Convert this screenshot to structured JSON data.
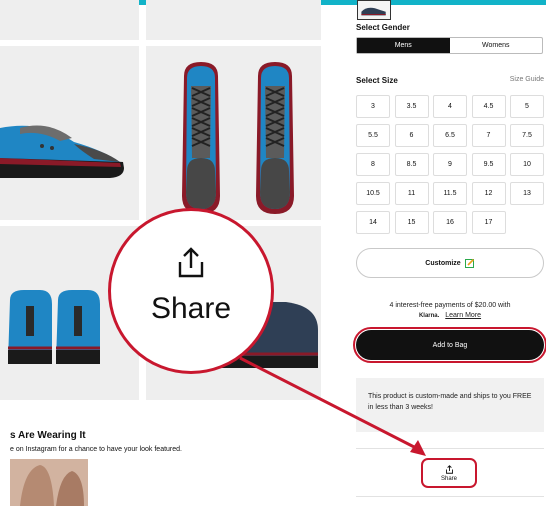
{
  "product": {
    "gender_label": "Select Gender",
    "genders": [
      "Mens",
      "Womens"
    ],
    "size_label": "Select Size",
    "size_guide": "Size Guide",
    "sizes": [
      "3",
      "3.5",
      "4",
      "4.5",
      "5",
      "5.5",
      "6",
      "6.5",
      "7",
      "7.5",
      "8",
      "8.5",
      "9",
      "9.5",
      "10",
      "10.5",
      "11",
      "11.5",
      "12",
      "13",
      "14",
      "15",
      "16",
      "17"
    ],
    "customize": "Customize",
    "payment_line": "4 interest-free payments of $20.00 with",
    "klarna": "Klarna.",
    "learn_more": "Learn More",
    "add_to_bag": "Add to Bag",
    "notice": "This product is custom-made and ships to you FREE in less than 3 weeks!",
    "share": "Share"
  },
  "wearing": {
    "title": "s Are Wearing It",
    "subtitle": "e on Instagram for a chance to have your look featured."
  },
  "callout": {
    "label": "Share",
    "icon": "share-icon"
  },
  "colors": {
    "accent_teal": "#12b3c8",
    "annotation_red": "#c8172e",
    "shoe_blue": "#1f86c4",
    "shoe_dark": "#2f3f55"
  }
}
